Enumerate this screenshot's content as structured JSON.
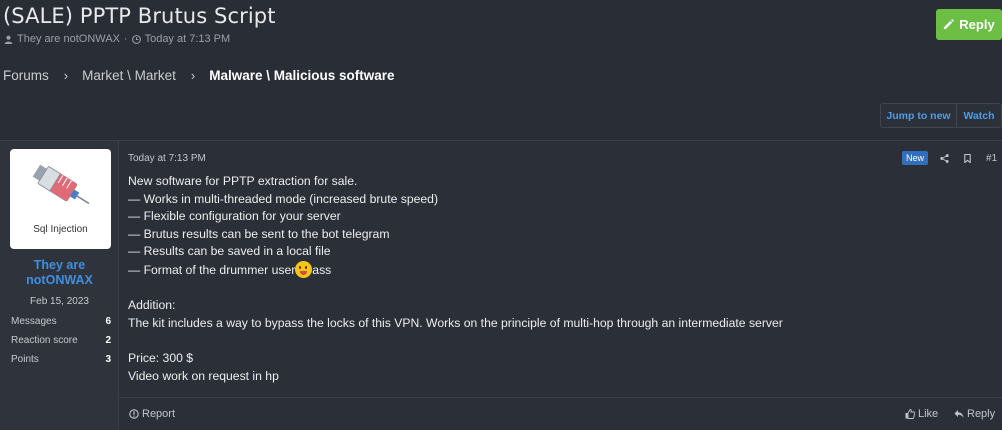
{
  "thread": {
    "title": "(SALE) PPTP Brutus Script",
    "author": "They are notONWAX",
    "separator": "·",
    "time": "Today at 7:13 PM"
  },
  "actions": {
    "reply_label": "Reply",
    "jump_label": "Jump to new",
    "watch_label": "Watch"
  },
  "breadcrumb": {
    "items": [
      "Forums",
      "Market \\ Market",
      "Malware \\ Malicious software"
    ]
  },
  "post": {
    "user": {
      "avatar_caption": "Sql Injection",
      "name_line1": "They are",
      "name_line2": "notONWAX",
      "joined": "Feb 15, 2023",
      "stats": [
        {
          "label": "Messages",
          "value": "6"
        },
        {
          "label": "Reaction score",
          "value": "2"
        },
        {
          "label": "Points",
          "value": "3"
        }
      ]
    },
    "date": "Today at 7:13 PM",
    "badge": "New",
    "number": "#1",
    "lines": [
      "New software for PPTP extraction for sale.",
      "— Works in multi-threaded mode (increased brute speed)",
      "— Flexible configuration for your server",
      "— Brutus results can be sent to the bot telegram",
      "— Results can be saved in a local file"
    ],
    "format_line_pre": "— Format of the drummer user",
    "format_line_post": "ass",
    "addition_heading": "Addition:",
    "addition_text": "The kit includes a way to bypass the locks of this VPN. Works on the principle of multi-hop through an intermediate server",
    "price": "Price: 300 $",
    "video": "Video work on request in hp",
    "footer": {
      "report": "Report",
      "like": "Like",
      "reply": "Reply"
    }
  },
  "colors": {
    "background": "#292d35",
    "reply_button": "#6cbe45",
    "link_blue": "#4d9de8",
    "username_blue": "#3f8fe0",
    "badge_new": "#2f6fbd"
  },
  "icons": [
    "user-icon",
    "clock-icon",
    "pencil-icon",
    "chevron-right-icon",
    "share-icon",
    "bookmark-icon",
    "report-icon",
    "like-icon",
    "reply-icon",
    "syringe-icon",
    "smiley-tongue-icon"
  ]
}
